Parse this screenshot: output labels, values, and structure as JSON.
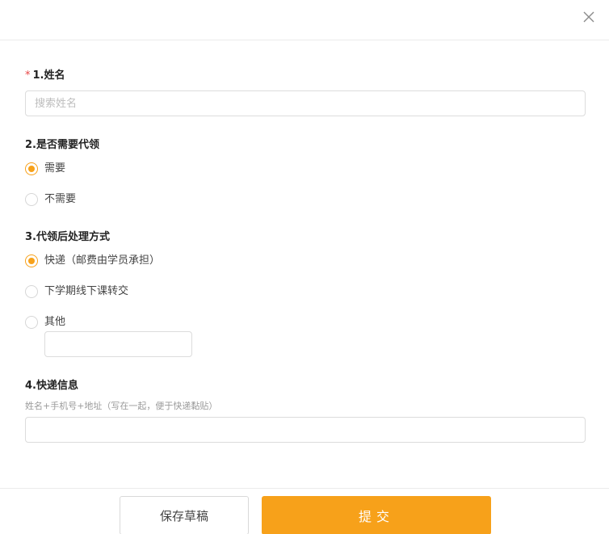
{
  "form": {
    "q1": {
      "required_mark": "*",
      "label": "1.姓名",
      "placeholder": "搜索姓名",
      "value": ""
    },
    "q2": {
      "label": "2.是否需要代领",
      "options": [
        {
          "label": "需要",
          "checked": true
        },
        {
          "label": "不需要",
          "checked": false
        }
      ]
    },
    "q3": {
      "label": "3.代领后处理方式",
      "options": [
        {
          "label": "快递（邮费由学员承担）",
          "checked": true
        },
        {
          "label": "下学期线下课转交",
          "checked": false
        },
        {
          "label": "其他",
          "checked": false
        }
      ],
      "other_value": ""
    },
    "q4": {
      "label": "4.快递信息",
      "hint": "姓名+手机号+地址（写在一起，便于快递黏贴）",
      "value": ""
    }
  },
  "footer": {
    "draft_label": "保存草稿",
    "submit_label": "提交"
  },
  "colors": {
    "accent": "#f7a11a",
    "required": "#e84545",
    "border": "#dcdcdc"
  },
  "icons": {
    "close": "close-icon"
  }
}
